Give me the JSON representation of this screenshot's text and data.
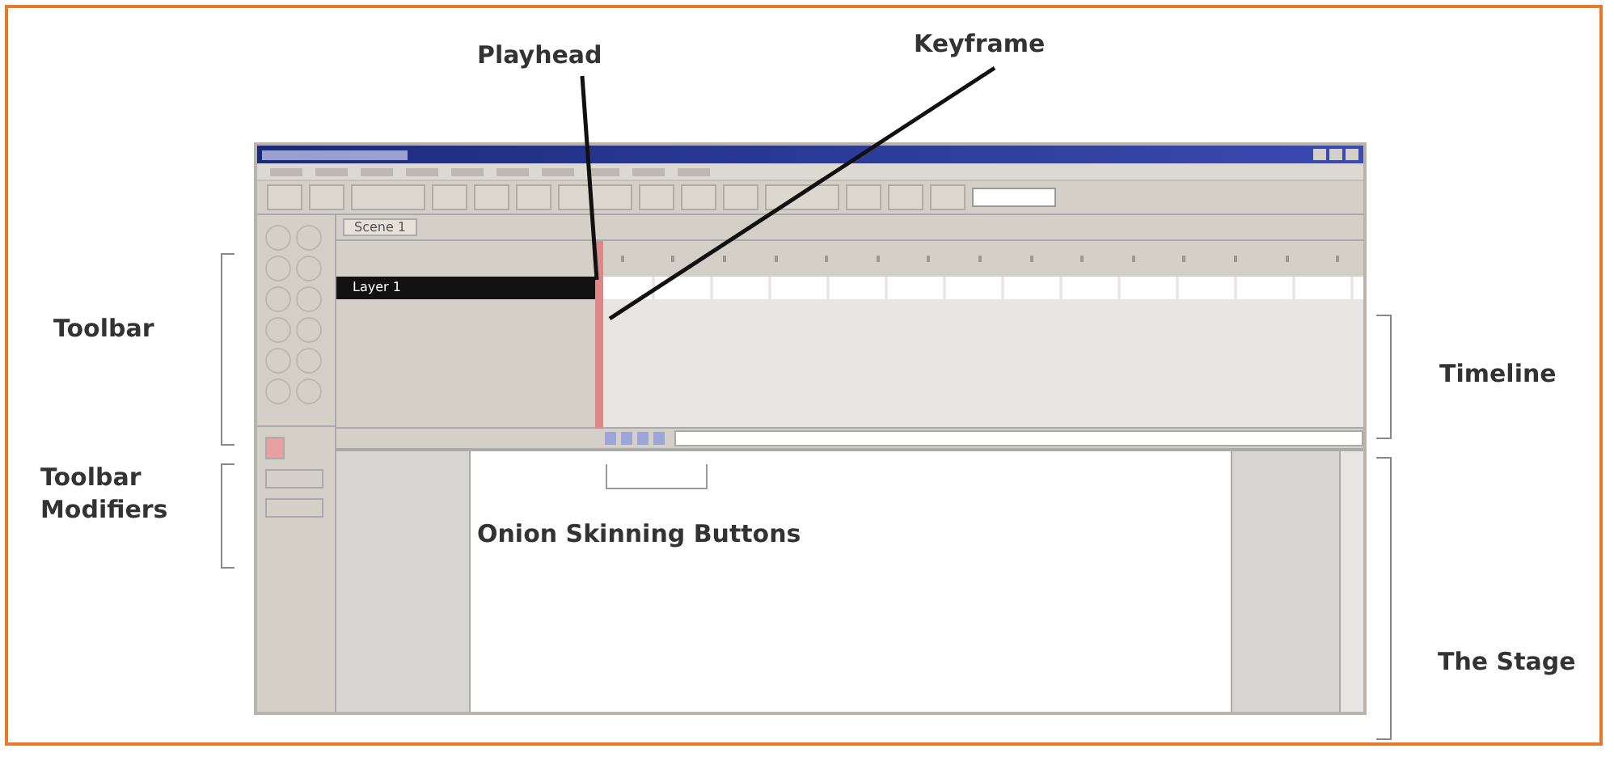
{
  "annotations": [
    {
      "kind": "top",
      "label": "Playhead"
    },
    {
      "kind": "top",
      "label": "Keyframe"
    },
    {
      "kind": "left",
      "label": "Toolbar"
    },
    {
      "kind": "left",
      "label": "Toolbar Modifiers"
    },
    {
      "kind": "right",
      "label": "Timeline"
    },
    {
      "kind": "right",
      "label": "The Stage"
    },
    {
      "kind": "inside",
      "label": "Onion Skinning Buttons"
    }
  ],
  "scene_tab": {
    "label": "Scene 1"
  },
  "layers": [
    {
      "name": "Layer 1",
      "selected": true
    }
  ]
}
